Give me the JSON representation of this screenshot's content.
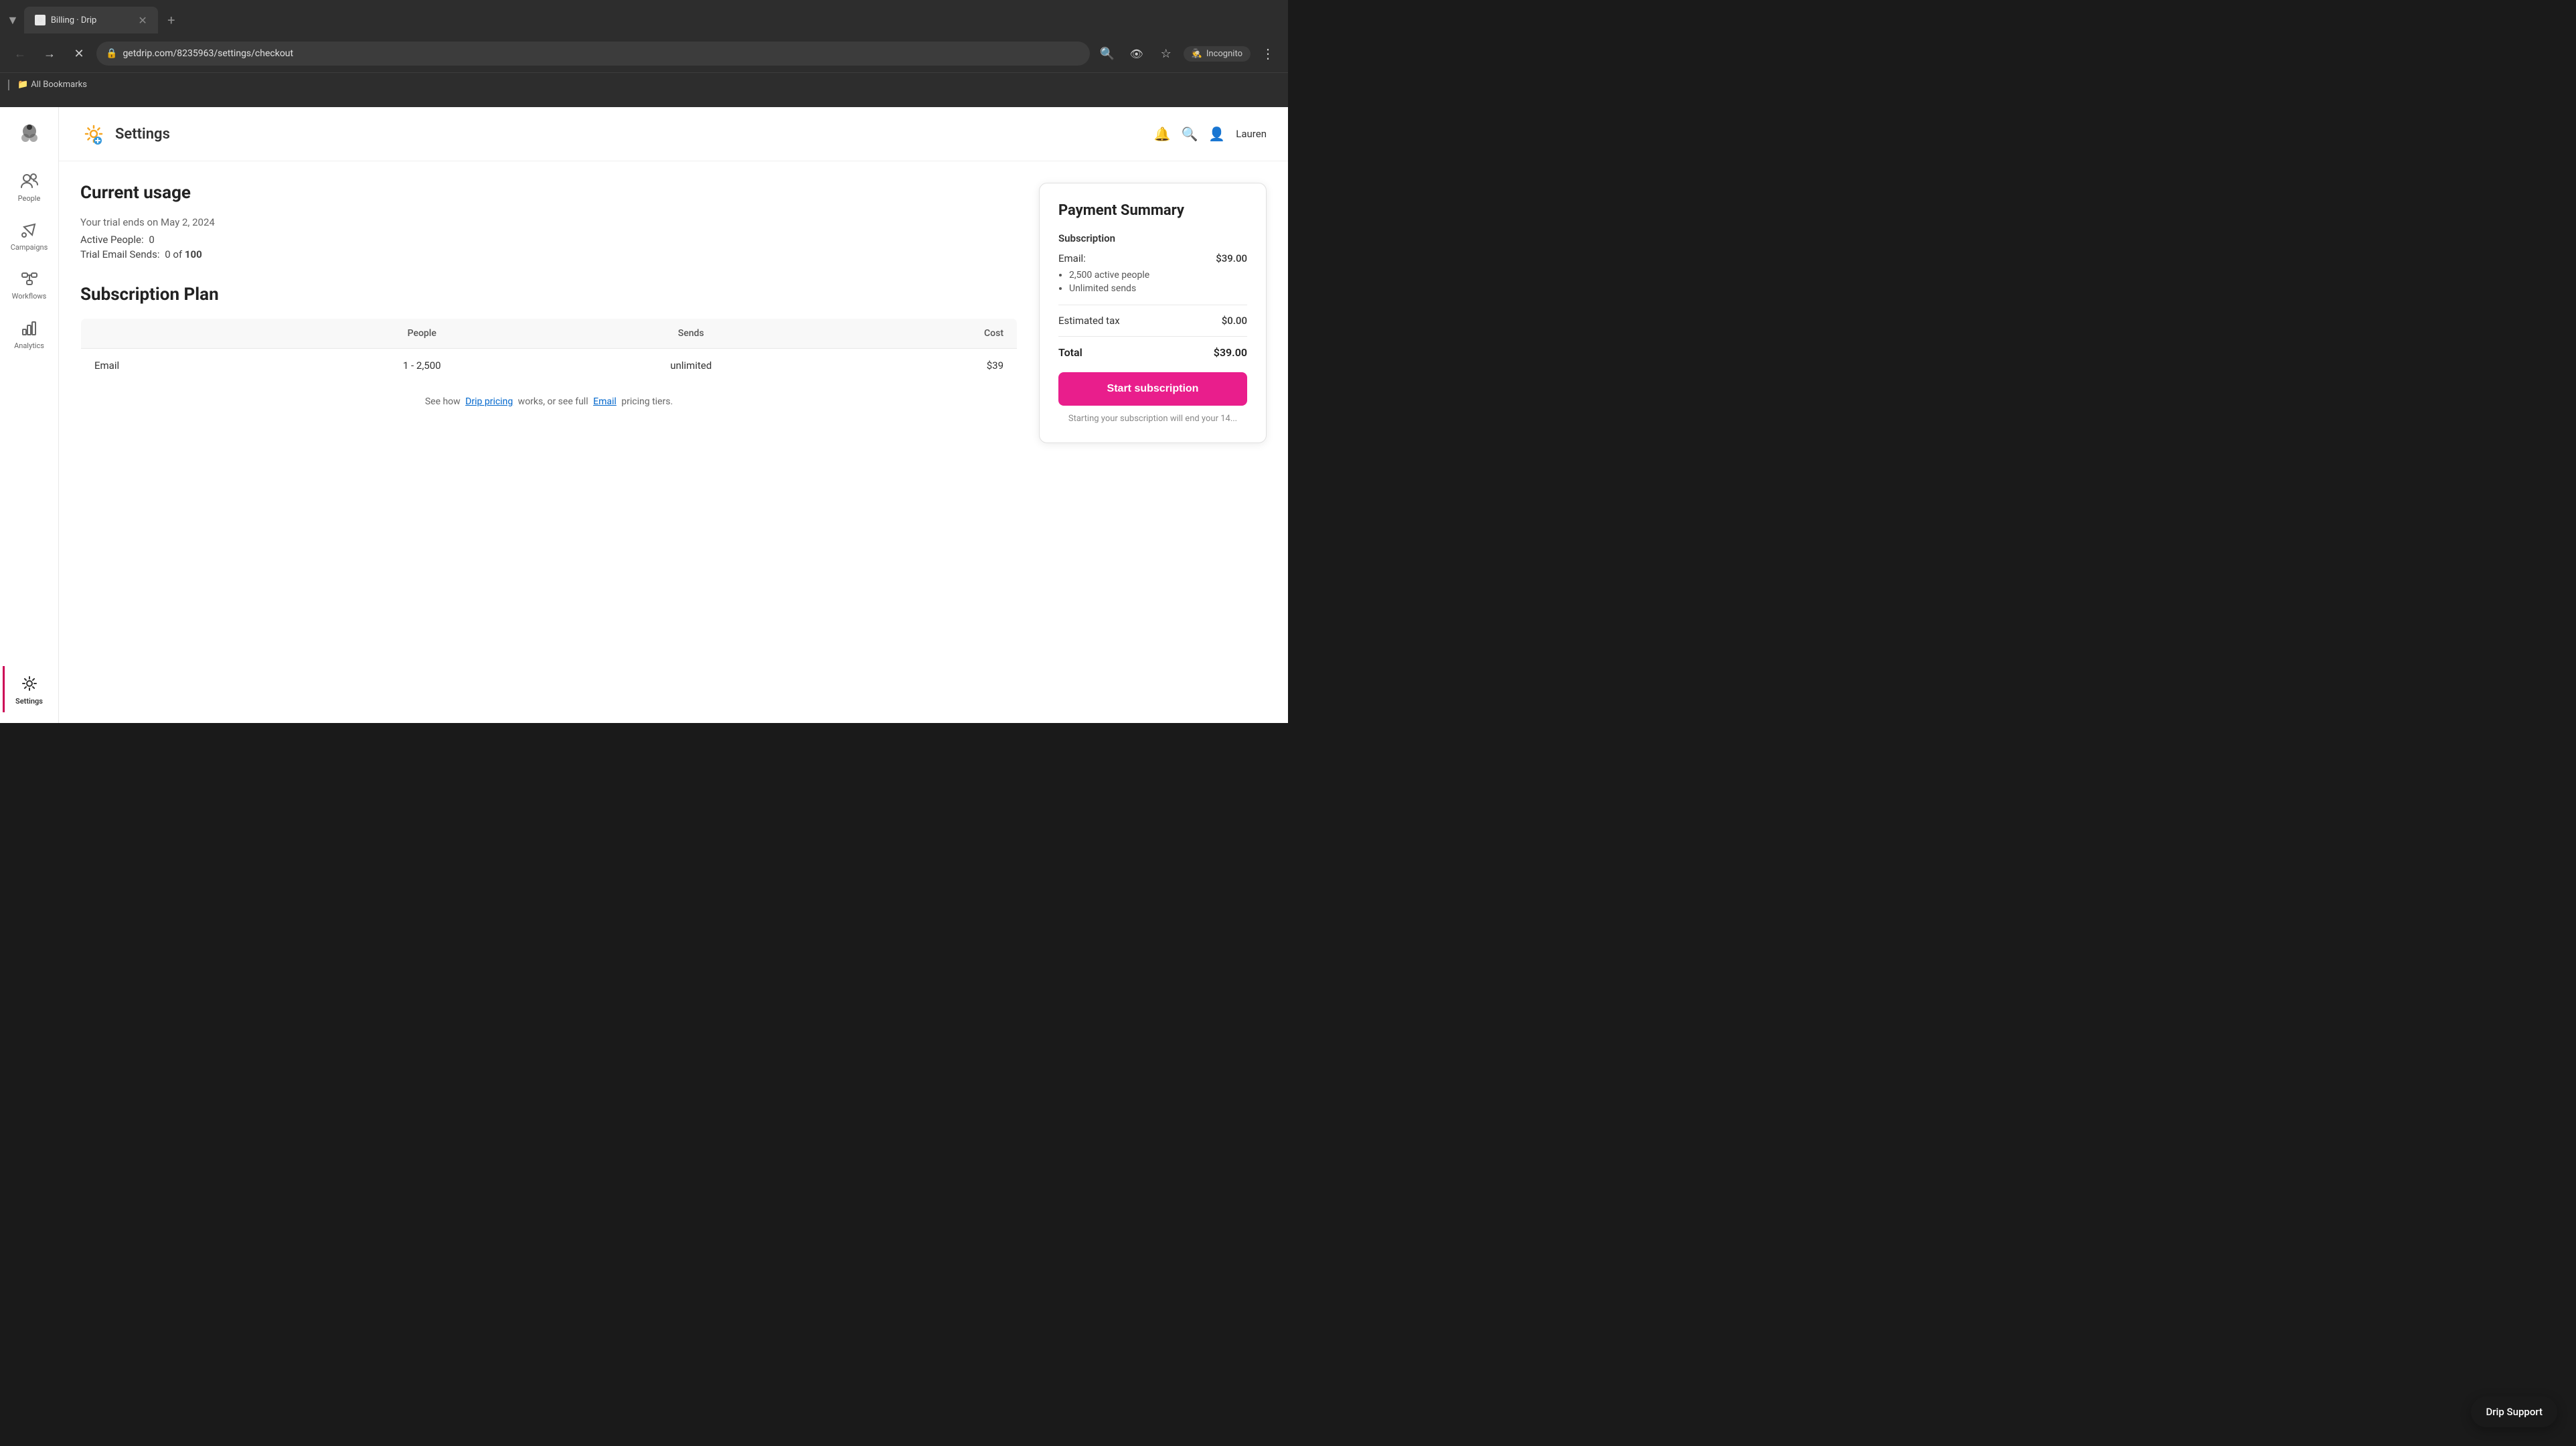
{
  "browser": {
    "tab_title": "Billing · Drip",
    "tab_favicon": "🌀",
    "url": "getdrip.com/8235963/settings/checkout",
    "new_tab_label": "+",
    "incognito_label": "Incognito",
    "bookmarks_folder_label": "All Bookmarks"
  },
  "header": {
    "settings_label": "Settings",
    "bell_icon": "🔔",
    "search_icon": "🔍",
    "user_icon": "👤",
    "user_name": "Lauren"
  },
  "sidebar": {
    "logo_title": "Drip Logo",
    "items": [
      {
        "id": "people",
        "label": "People",
        "icon": "👥",
        "active": false
      },
      {
        "id": "campaigns",
        "label": "Campaigns",
        "icon": "📣",
        "active": false
      },
      {
        "id": "workflows",
        "label": "Workflows",
        "icon": "⚡",
        "active": false
      },
      {
        "id": "analytics",
        "label": "Analytics",
        "icon": "📊",
        "active": false
      },
      {
        "id": "settings",
        "label": "Settings",
        "icon": "⚙️",
        "active": true
      }
    ]
  },
  "current_usage": {
    "title": "Current usage",
    "trial_text": "Your trial ends on May 2, 2024",
    "active_people_label": "Active People:",
    "active_people_value": "0",
    "email_sends_label": "Trial Email Sends:",
    "email_sends_value": "0 of 100"
  },
  "subscription_plan": {
    "title": "Subscription Plan",
    "table_headers": [
      "",
      "People",
      "Sends",
      "Cost"
    ],
    "rows": [
      {
        "plan_name": "Email",
        "people_range": "1 - 2,500",
        "sends": "unlimited",
        "cost": "$39"
      }
    ],
    "pricing_note_prefix": "See how",
    "drip_pricing_link": "Drip pricing",
    "pricing_note_middle": "works, or see full",
    "email_link": "Email",
    "pricing_note_suffix": "pricing tiers."
  },
  "payment_summary": {
    "title": "Payment Summary",
    "subscription_label": "Subscription",
    "email_label": "Email:",
    "email_cost": "$39.00",
    "bullets": [
      "2,500 active people",
      "Unlimited sends"
    ],
    "tax_label": "Estimated tax",
    "tax_value": "$0.00",
    "total_label": "Total",
    "total_value": "$39.00",
    "start_button_label": "Start subscription",
    "subscription_note": "Starting your subscription will end your 14..."
  },
  "drip_support": {
    "label": "Drip Support"
  },
  "colors": {
    "accent_pink": "#e91e8c",
    "link_blue": "#0066cc",
    "sidebar_active_border": "#ff0066"
  }
}
